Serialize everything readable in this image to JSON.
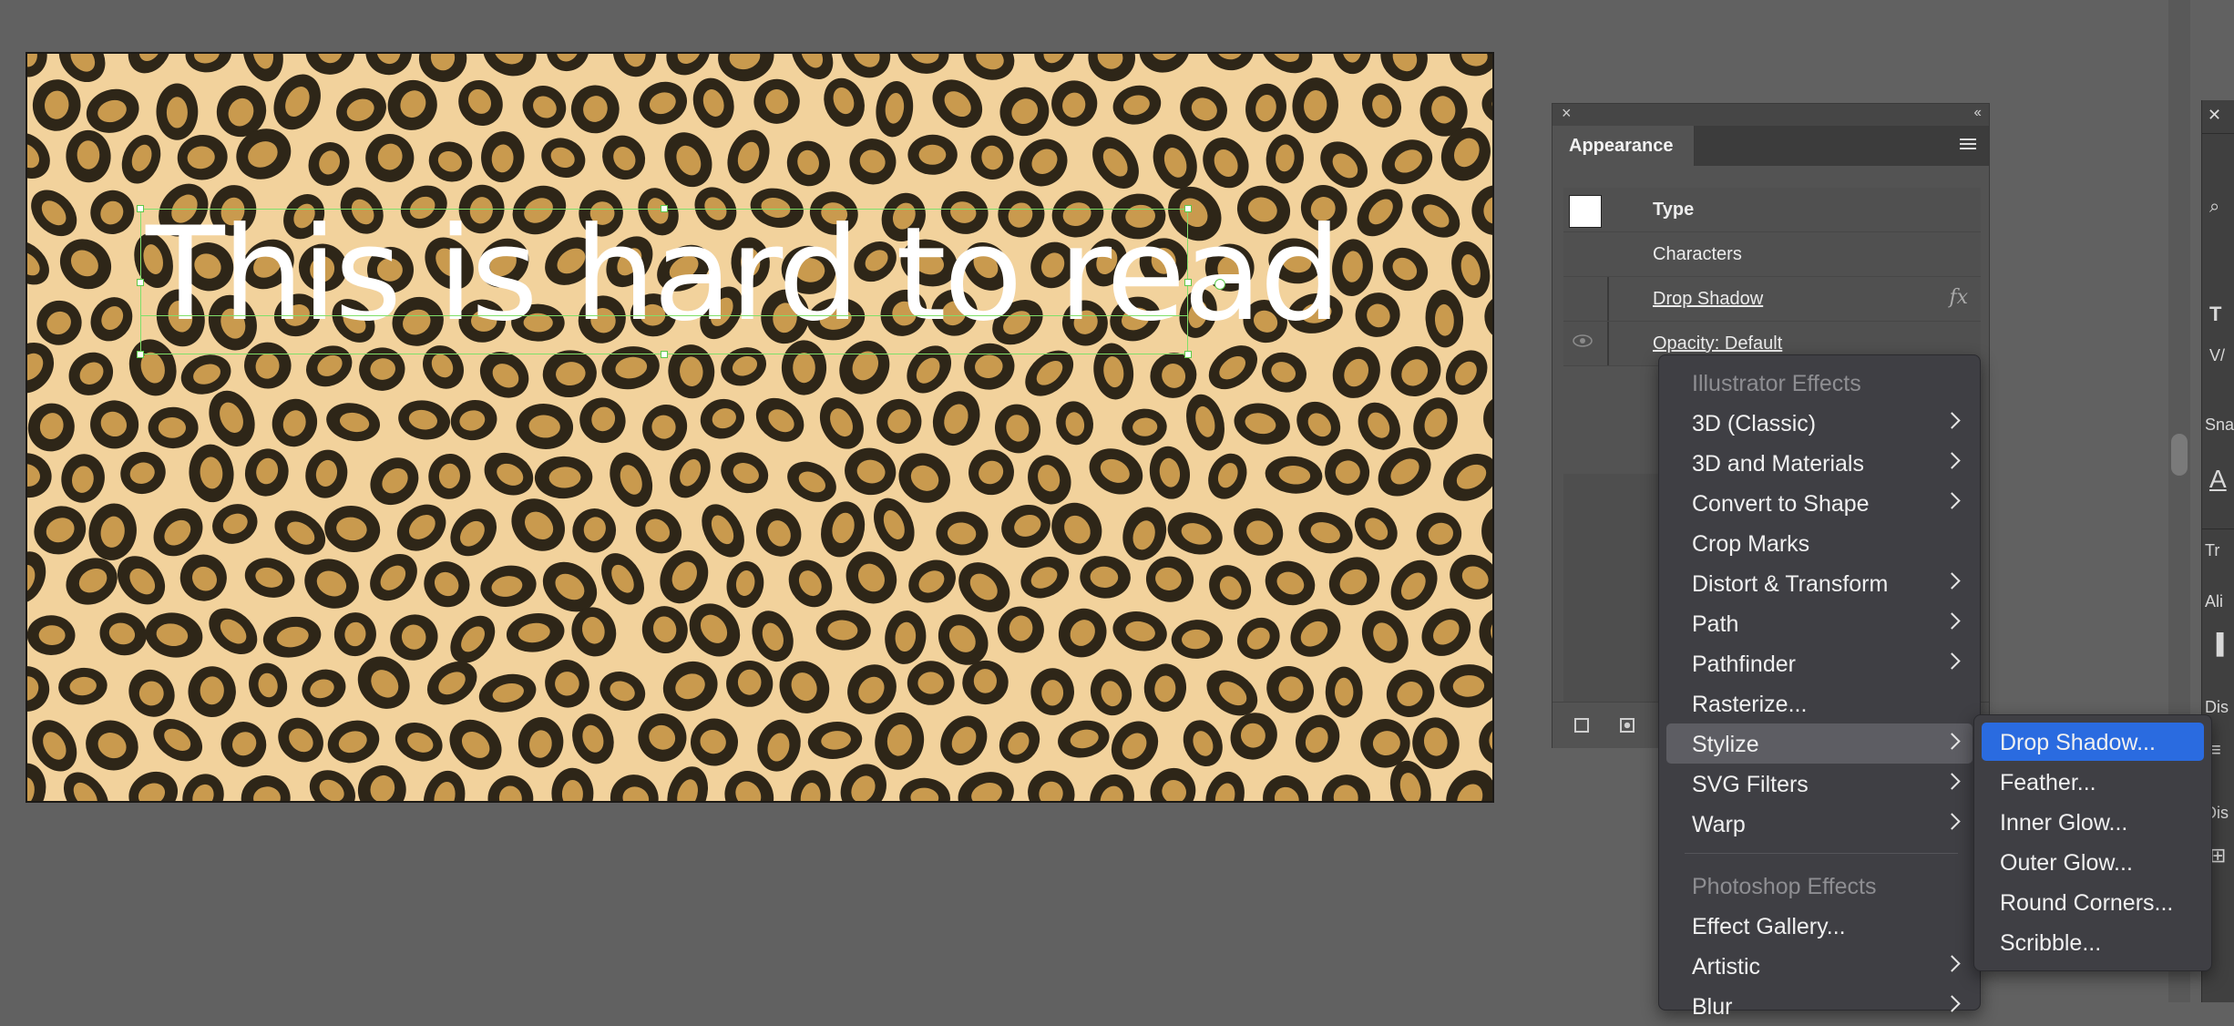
{
  "artboard": {
    "text": "This is hard to read",
    "pattern": "leopard-print",
    "colors": {
      "base": "#f2d29c",
      "spot_dark": "#2e2618",
      "spot_fill": "#c99a4e"
    }
  },
  "appearance_panel": {
    "tab": "Appearance",
    "rows": [
      {
        "label": "Type"
      },
      {
        "label": "Characters"
      },
      {
        "label": "Drop Shadow",
        "fx": "fx"
      },
      {
        "label": "Opacity:  Default"
      }
    ]
  },
  "effects_menu": {
    "illustrator_header": "Illustrator Effects",
    "illustrator_items": [
      {
        "label": "3D (Classic)",
        "submenu": true
      },
      {
        "label": "3D and Materials",
        "submenu": true
      },
      {
        "label": "Convert to Shape",
        "submenu": true
      },
      {
        "label": "Crop Marks",
        "submenu": false
      },
      {
        "label": "Distort & Transform",
        "submenu": true
      },
      {
        "label": "Path",
        "submenu": true
      },
      {
        "label": "Pathfinder",
        "submenu": true
      },
      {
        "label": "Rasterize...",
        "submenu": false
      },
      {
        "label": "Stylize",
        "submenu": true,
        "highlighted": true
      },
      {
        "label": "SVG Filters",
        "submenu": true
      },
      {
        "label": "Warp",
        "submenu": true
      }
    ],
    "photoshop_header": "Photoshop Effects",
    "photoshop_items": [
      {
        "label": "Effect Gallery...",
        "submenu": false
      },
      {
        "label": "Artistic",
        "submenu": true
      },
      {
        "label": "Blur",
        "submenu": true
      }
    ]
  },
  "stylize_submenu": {
    "items": [
      {
        "label": "Drop Shadow...",
        "selected": true
      },
      {
        "label": "Feather..."
      },
      {
        "label": "Inner Glow..."
      },
      {
        "label": "Outer Glow..."
      },
      {
        "label": "Round Corners..."
      },
      {
        "label": "Scribble..."
      }
    ]
  },
  "right_panel": {
    "glyphs": [
      "T",
      "V/",
      "Sna",
      "A",
      "Tr",
      "Ali",
      "Dis",
      "Dis"
    ]
  }
}
